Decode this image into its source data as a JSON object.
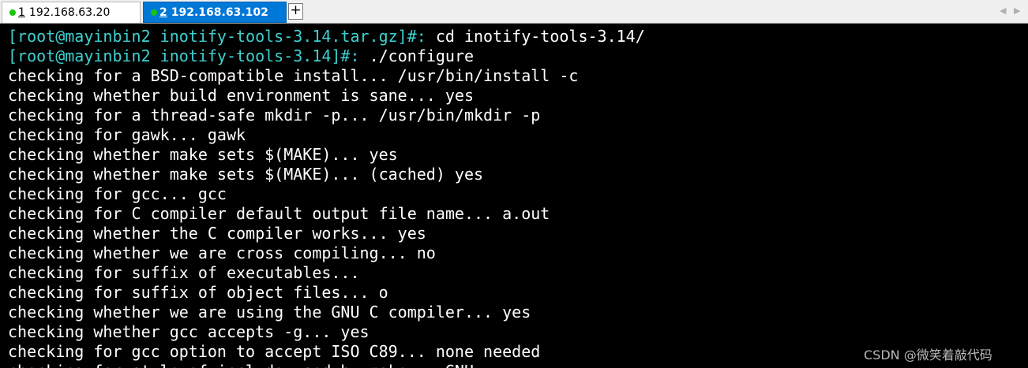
{
  "tabs": [
    {
      "index": "1",
      "title": "192.168.63.20",
      "status_color": "#16c60c",
      "active": false
    },
    {
      "index": "2",
      "title": "192.168.63.102",
      "status_color": "#16c60c",
      "active": true
    }
  ],
  "tabbar": {
    "new_tab_label": "+",
    "scroll_left": "◀",
    "scroll_right": "▶"
  },
  "terminal": {
    "lines": [
      {
        "prompt": "[root@mayinbin2 inotify-tools-3.14.tar.gz]#:",
        "text": " cd inotify-tools-3.14/"
      },
      {
        "prompt": "[root@mayinbin2 inotify-tools-3.14]#:",
        "text": " ./configure"
      },
      {
        "prompt": "",
        "text": "checking for a BSD-compatible install... /usr/bin/install -c"
      },
      {
        "prompt": "",
        "text": "checking whether build environment is sane... yes"
      },
      {
        "prompt": "",
        "text": "checking for a thread-safe mkdir -p... /usr/bin/mkdir -p"
      },
      {
        "prompt": "",
        "text": "checking for gawk... gawk"
      },
      {
        "prompt": "",
        "text": "checking whether make sets $(MAKE)... yes"
      },
      {
        "prompt": "",
        "text": "checking whether make sets $(MAKE)... (cached) yes"
      },
      {
        "prompt": "",
        "text": "checking for gcc... gcc"
      },
      {
        "prompt": "",
        "text": "checking for C compiler default output file name... a.out"
      },
      {
        "prompt": "",
        "text": "checking whether the C compiler works... yes"
      },
      {
        "prompt": "",
        "text": "checking whether we are cross compiling... no"
      },
      {
        "prompt": "",
        "text": "checking for suffix of executables..."
      },
      {
        "prompt": "",
        "text": "checking for suffix of object files... o"
      },
      {
        "prompt": "",
        "text": "checking whether we are using the GNU C compiler... yes"
      },
      {
        "prompt": "",
        "text": "checking whether gcc accepts -g... yes"
      },
      {
        "prompt": "",
        "text": "checking for gcc option to accept ISO C89... none needed"
      },
      {
        "prompt": "",
        "text": "checking for style of include used by make... GNU"
      }
    ]
  },
  "watermark": "CSDN @微笑着敲代码",
  "colors": {
    "background": "#000000",
    "foreground": "#ffffff",
    "prompt": "#3fd0d0",
    "active_tab": "#0078d7"
  }
}
